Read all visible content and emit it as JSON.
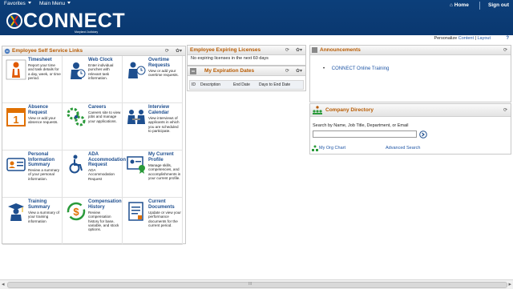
{
  "header": {
    "favorites": "Favorites",
    "main_menu": "Main Menu",
    "logo_text": "CONNECT",
    "logo_sub": "Maryland Judiciary",
    "home": "Home",
    "sign_out": "Sign out",
    "brand_color": "#0c3f7a"
  },
  "personalize": {
    "label": "Personalize",
    "content": "Content",
    "sep": "|",
    "layout": "Layout",
    "help": "?"
  },
  "ess": {
    "title": "Employee Self Service Links",
    "cells": [
      {
        "title": "Timesheet",
        "desc": "Report your time and task details for a day, week, or time period.",
        "icon": "timesheet-person-icon"
      },
      {
        "title": "Web Clock",
        "desc": "Enter individual punches with relevant task information.",
        "icon": "clock-person-icon"
      },
      {
        "title": "Overtime Requests",
        "desc": "View or add your overtime requests.",
        "icon": "overtime-person-icon"
      },
      {
        "title": "Absence Request",
        "desc": "View or add your absence requests.",
        "icon": "calendar-icon"
      },
      {
        "title": "Careers",
        "desc": "Careers site to view jobs and manage your applications.",
        "icon": "careers-gear-icon"
      },
      {
        "title": "Interview Calendar",
        "desc": "View interviews of applicants in which you are scheduled to participate.",
        "icon": "interview-icon"
      },
      {
        "title": "Personal Information Summary",
        "desc": "Review a summary of your personal information.",
        "icon": "id-card-icon"
      },
      {
        "title": "ADA Accommodation Request",
        "desc": "ADA Accommodation Request",
        "icon": "wheelchair-icon"
      },
      {
        "title": "My Current Profile",
        "desc": "Manage skills, competencies, and accomplishments in your current profile.",
        "icon": "profile-ribbon-icon"
      },
      {
        "title": "Training Summary",
        "desc": "View a summary of your training information",
        "icon": "graduate-icon"
      },
      {
        "title": "Compensation History",
        "desc": "Review compensation history for base, variable, and stock options.",
        "icon": "dollar-cycle-icon"
      },
      {
        "title": "Current Documents",
        "desc": "Update or view your performance documents for the current period.",
        "icon": "document-icon"
      }
    ]
  },
  "licenses": {
    "title": "Employee Expiring Licenses",
    "message": "No expiring licenses in the next 60 days"
  },
  "expirations": {
    "title": "My Expiration Dates",
    "columns": [
      "ID",
      "Description",
      "End Date",
      "Days to End Date"
    ]
  },
  "announcements": {
    "title": "Announcements",
    "items": [
      "CONNECT Online Training"
    ]
  },
  "directory": {
    "title": "Company Directory",
    "search_label": "Search by Name, Job Title, Department, or Email",
    "search_value": "",
    "org_chart": "My Org Chart",
    "advanced": "Advanced Search"
  },
  "scrollbar": {
    "grip": "III"
  }
}
